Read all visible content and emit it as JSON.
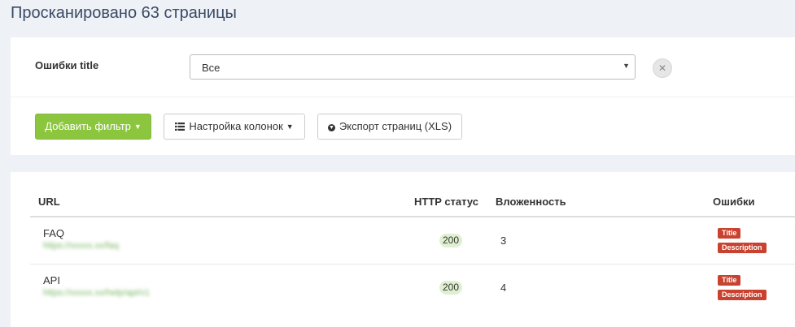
{
  "page": {
    "title": "Просканировано 63 страницы"
  },
  "filter": {
    "label": "Ошибки title",
    "select_value": "Все",
    "caret_icon": "caret-down-icon",
    "clear_icon": "close-icon"
  },
  "toolbar": {
    "add_filter_label": "Добавить фильтр",
    "columns_label": "Настройка колонок",
    "export_label": "Экспорт страниц (XLS)"
  },
  "table": {
    "headers": {
      "url": "URL",
      "http_status": "HTTP статус",
      "depth": "Вложенность",
      "errors": "Ошибки"
    },
    "rows": [
      {
        "title": "FAQ",
        "url": "https://xxxxx.xx/faq",
        "status": "200",
        "depth": "3",
        "errors": [
          "Title",
          "Description"
        ]
      },
      {
        "title": "API",
        "url": "https://xxxxx.xx/help/api/v1",
        "status": "200",
        "depth": "4",
        "errors": [
          "Title",
          "Description"
        ]
      }
    ]
  },
  "colors": {
    "primary_green": "#8cc63f",
    "error_red": "#c9412f",
    "status_bg": "#dff0d0",
    "page_bg": "#eef1f5"
  }
}
